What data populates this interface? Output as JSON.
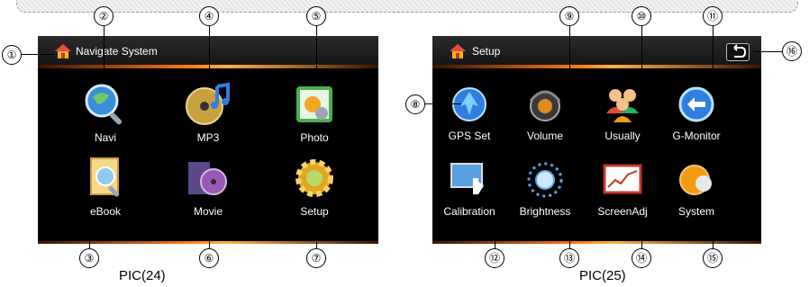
{
  "screen1": {
    "title": "Navigate System",
    "apps": [
      {
        "label": "Navi",
        "icon": "magnifier-globe-icon"
      },
      {
        "label": "MP3",
        "icon": "music-disc-icon"
      },
      {
        "label": "Photo",
        "icon": "photo-icon"
      },
      {
        "label": "eBook",
        "icon": "ebook-icon"
      },
      {
        "label": "Movie",
        "icon": "movie-reel-icon"
      },
      {
        "label": "Setup",
        "icon": "gear-icon"
      }
    ],
    "caption": "PIC(24)"
  },
  "screen2": {
    "title": "Setup",
    "apps": [
      {
        "label": "GPS Set",
        "icon": "gps-globe-icon"
      },
      {
        "label": "Volume",
        "icon": "speaker-icon"
      },
      {
        "label": "Usually",
        "icon": "users-icon"
      },
      {
        "label": "G-Monitor",
        "icon": "monitor-globe-icon"
      },
      {
        "label": "Calibration",
        "icon": "touch-calibration-icon"
      },
      {
        "label": "Brightness",
        "icon": "brightness-sun-icon"
      },
      {
        "label": "ScreenAdj",
        "icon": "screen-adjust-icon"
      },
      {
        "label": "System",
        "icon": "system-icon"
      }
    ],
    "back_icon": "back-arrow-icon",
    "caption": "PIC(25)"
  },
  "callouts": [
    "①",
    "②",
    "③",
    "④",
    "⑤",
    "⑥",
    "⑦",
    "⑧",
    "⑨",
    "⑩",
    "⑪",
    "⑫",
    "⑬",
    "⑭",
    "⑮",
    "⑯"
  ],
  "colors": {
    "accent": "#ff7a1a",
    "screen_bg": "#000000",
    "label": "#ffffff"
  }
}
